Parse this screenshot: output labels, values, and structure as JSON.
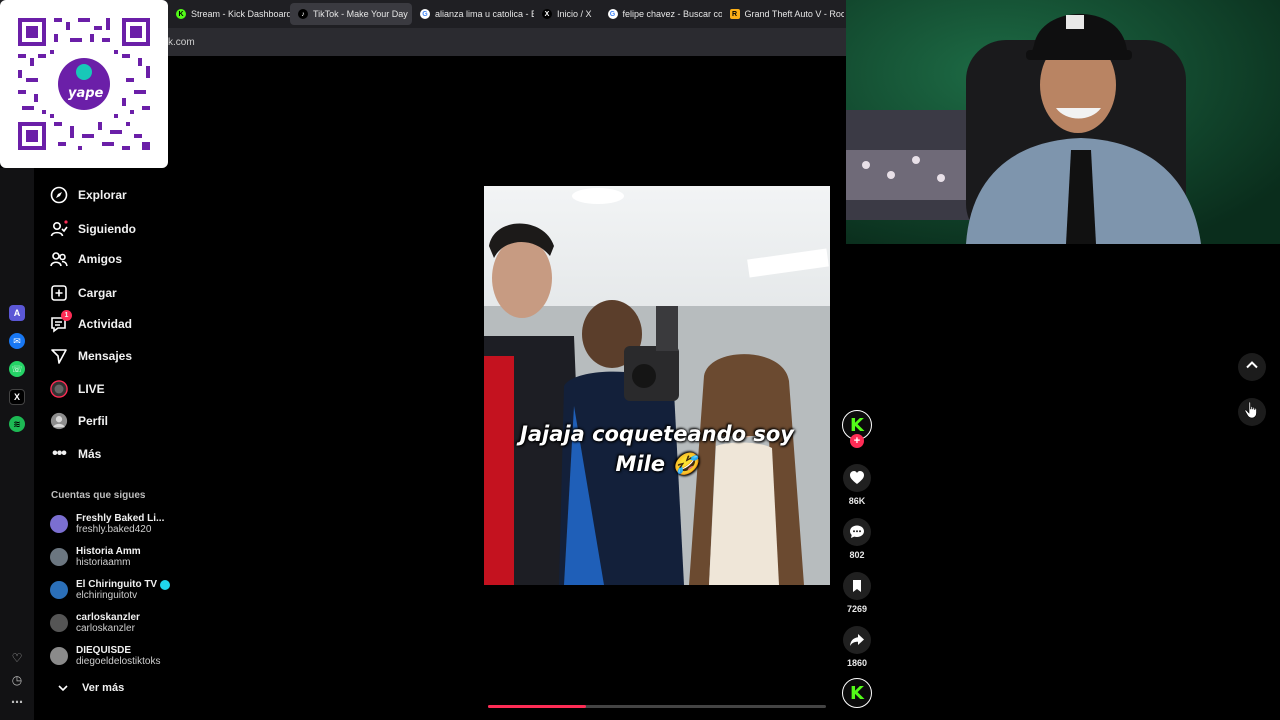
{
  "tabs": [
    {
      "title": "Stream - Kick Dashboard",
      "icon": "kick-icon",
      "color": "#53fc18",
      "active": false
    },
    {
      "title": "TikTok - Make Your Day",
      "icon": "tiktok-icon",
      "color": "#ffffff",
      "active": true
    },
    {
      "title": "alianza lima u catolica - B",
      "icon": "google-icon",
      "color": "#4285f4",
      "active": false
    },
    {
      "title": "Inicio / X",
      "icon": "x-icon",
      "color": "#ffffff",
      "active": false
    },
    {
      "title": "felipe chavez - Buscar con",
      "icon": "google-icon",
      "color": "#4285f4",
      "active": false
    },
    {
      "title": "Grand Theft Auto V - Rock",
      "icon": "rockstar-icon",
      "color": "#fcaf17",
      "active": false
    }
  ],
  "address": "k.com",
  "qr_label": "yape",
  "nav": [
    {
      "label": "Explorar",
      "icon": "compass-icon"
    },
    {
      "label": "Siguiendo",
      "icon": "following-icon"
    },
    {
      "label": "Amigos",
      "icon": "friends-icon"
    },
    {
      "label": "Cargar",
      "icon": "upload-icon"
    },
    {
      "label": "Actividad",
      "icon": "activity-icon",
      "badge": "1"
    },
    {
      "label": "Mensajes",
      "icon": "messages-icon"
    },
    {
      "label": "LIVE",
      "icon": "live-icon"
    },
    {
      "label": "Perfil",
      "icon": "profile-icon"
    },
    {
      "label": "Más",
      "icon": "more-icon"
    }
  ],
  "following_title": "Cuentas que sigues",
  "accounts": [
    {
      "name": "Freshly Baked Li...",
      "handle": "freshly.baked420",
      "verified": false,
      "color": "#7b6fd1"
    },
    {
      "name": "Historia Amm",
      "handle": "historiaamm",
      "verified": false,
      "color": "#6b7680"
    },
    {
      "name": "El Chiringuito TV",
      "handle": "elchiringuitotv",
      "verified": true,
      "color": "#2b6fb8"
    },
    {
      "name": "carloskanzler",
      "handle": "carloskanzler",
      "verified": false,
      "color": "#555"
    },
    {
      "name": "DIEQUISDE",
      "handle": "diegoeldelostiktoks",
      "verified": false,
      "color": "#8a8a8a"
    }
  ],
  "see_more": "Ver más",
  "video": {
    "caption_line1": "Jajaja coqueteando soy",
    "caption_line2": "Mile 🤣",
    "progress": 0.29
  },
  "actions": {
    "likes": "86K",
    "comments": "802",
    "saves": "7269",
    "shares": "1860"
  },
  "kick_letter": "K",
  "colors": {
    "accent": "#fe2c55",
    "kick": "#53fc18"
  }
}
